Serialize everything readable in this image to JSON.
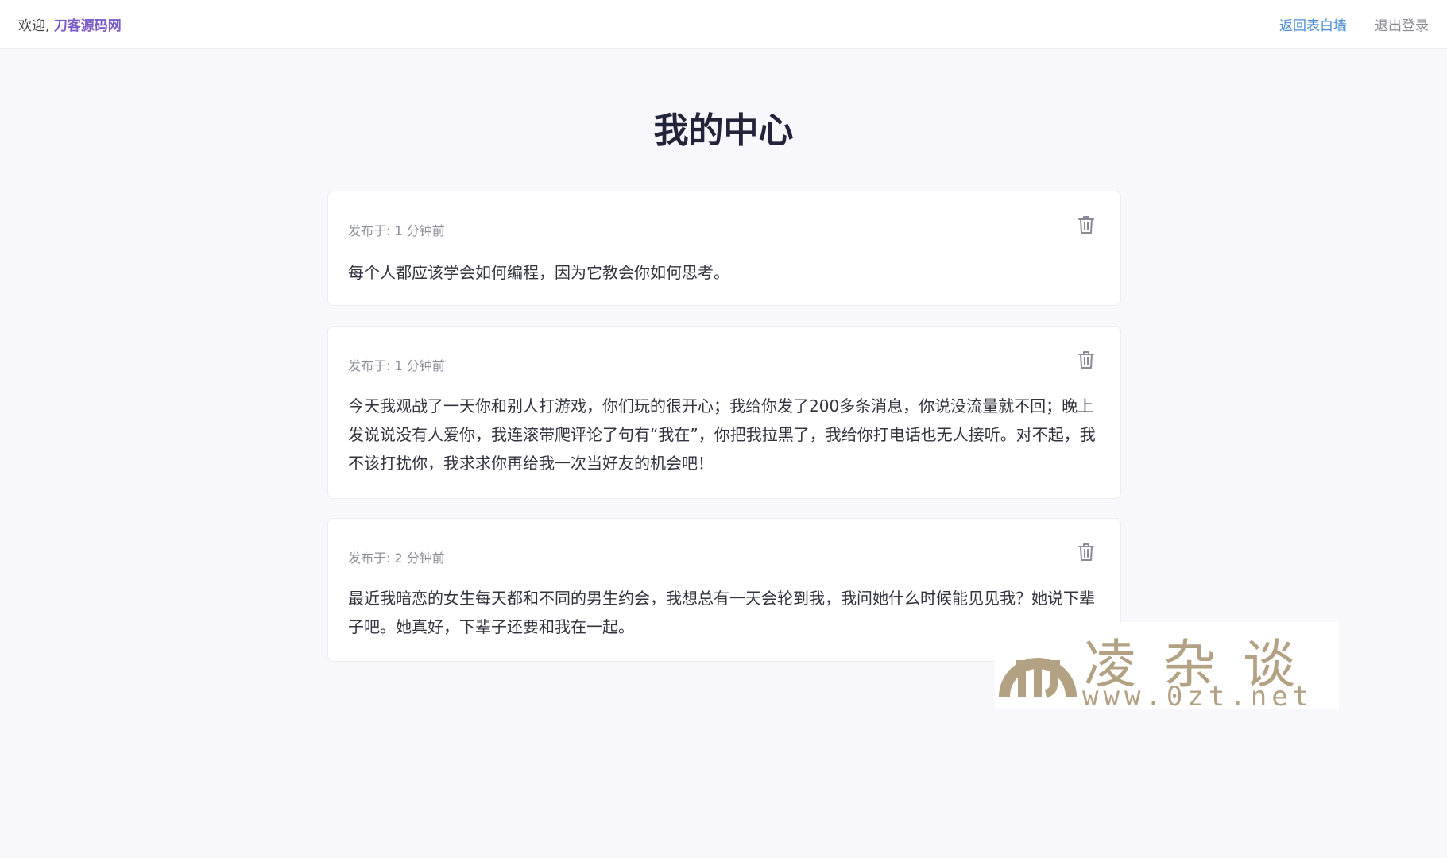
{
  "header": {
    "welcome_prefix": "欢迎, ",
    "username": "刀客源码网",
    "back_link": "返回表白墙",
    "logout_link": "退出登录"
  },
  "page": {
    "title": "我的中心"
  },
  "posts": [
    {
      "meta": "发布于: 1 分钟前",
      "content": "每个人都应该学会如何编程，因为它教会你如何思考。"
    },
    {
      "meta": "发布于: 1 分钟前",
      "content": "今天我观战了一天你和别人打游戏，你们玩的很开心；我给你发了200多条消息，你说没流量就不回；晚上发说说没有人爱你，我连滚带爬评论了句有“我在”，你把我拉黑了，我给你打电话也无人接听。对不起，我不该打扰你，我求求你再给我一次当好友的机会吧！"
    },
    {
      "meta": "发布于: 2 分钟前",
      "content": "最近我暗恋的女生每天都和不同的男生约会，我想总有一天会轮到我，我问她什么时候能见见我？她说下辈子吧。她真好，下辈子还要和我在一起。"
    }
  ],
  "icons": {
    "delete": "trash-icon"
  },
  "watermark": {
    "text_cn": "凌杂谈",
    "url": "www.0zt.net"
  },
  "colors": {
    "accent_username": "#7a5cc8",
    "link_blue": "#4d8fd6",
    "watermark": "#b3a183"
  }
}
